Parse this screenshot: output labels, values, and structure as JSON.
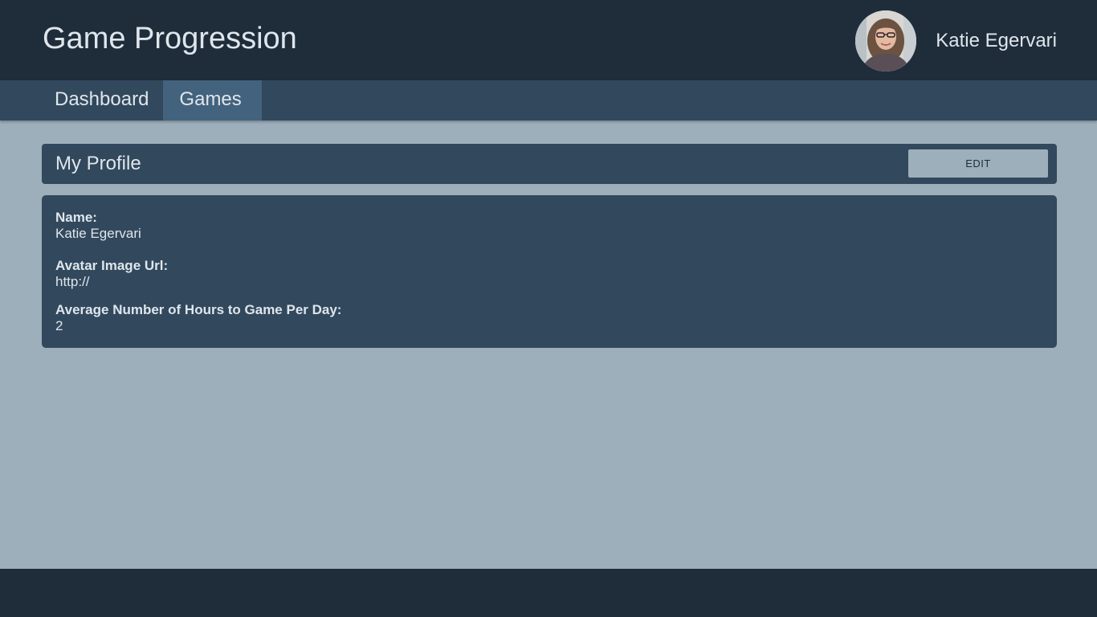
{
  "header": {
    "title": "Game Progression",
    "user_name": "Katie Egervari"
  },
  "nav": {
    "tabs": [
      {
        "label": "Dashboard",
        "active": false
      },
      {
        "label": "Games",
        "active": true
      }
    ]
  },
  "profile": {
    "title": "My Profile",
    "edit_label": "EDIT",
    "fields": [
      {
        "label": "Name:",
        "value": "Katie Egervari"
      },
      {
        "label": "Avatar Image Url:",
        "value": "http://"
      },
      {
        "label": "Average Number of Hours to Game Per Day:",
        "value": "2"
      }
    ]
  },
  "colors": {
    "header_bg": "#1f2d3b",
    "nav_bg": "#32485d",
    "nav_active_bg": "#43627d",
    "page_bg": "#9eafbc",
    "text": "#dfe6ec"
  }
}
